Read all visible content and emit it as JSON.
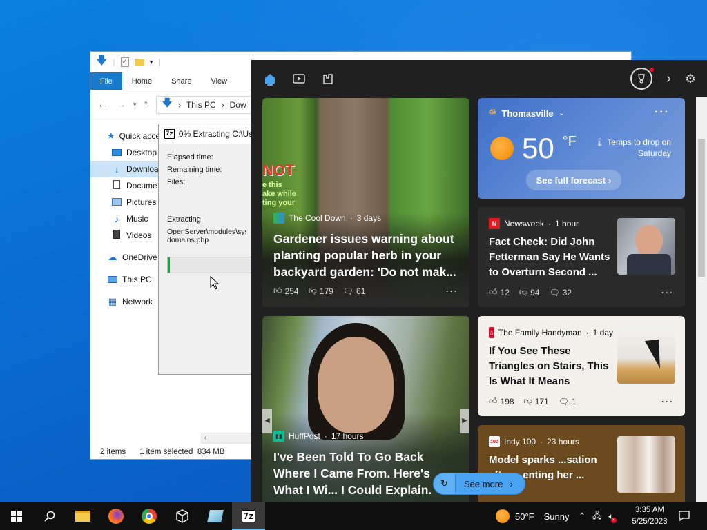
{
  "explorer": {
    "ribbon_tabs": [
      "File",
      "Home",
      "Share",
      "View"
    ],
    "breadcrumb": [
      "This PC",
      "Dow"
    ],
    "nav": [
      {
        "label": "Quick acce",
        "icon": "star-icon"
      },
      {
        "label": "Desktop",
        "icon": "desktop-icon"
      },
      {
        "label": "Downloa",
        "icon": "download-icon"
      },
      {
        "label": "Docume",
        "icon": "document-icon"
      },
      {
        "label": "Pictures",
        "icon": "pictures-icon"
      },
      {
        "label": "Music",
        "icon": "music-icon"
      },
      {
        "label": "Videos",
        "icon": "videos-icon"
      },
      {
        "label": "OneDrive",
        "icon": "cloud-icon"
      },
      {
        "label": "This PC",
        "icon": "pc-icon"
      },
      {
        "label": "Network",
        "icon": "network-icon"
      }
    ],
    "status": {
      "items": "2 items",
      "selected": "1 item selected",
      "size": "834 MB"
    }
  },
  "zip_dialog": {
    "logo": "7z",
    "title": "0% Extracting C:\\Us",
    "elapsed_label": "Elapsed time:",
    "remaining_label": "Remaining time:",
    "files_label": "Files:",
    "extracting_label": "Extracting",
    "path_line1": "OpenServer\\modules\\syst",
    "path_line2": "domains.php",
    "progress": 0.02
  },
  "widgets": {
    "weather": {
      "location": "Thomasville",
      "temp": "50",
      "unit": "°F",
      "alert": "Temps to drop on Saturday",
      "forecast_btn": "See full forecast"
    },
    "cards": [
      {
        "source": "The Cool Down",
        "age": "3 days",
        "headline": "Gardener issues warning about planting popular herb in your backyard garden: 'Do not mak...",
        "likes": "254",
        "dislikes": "179",
        "comments": "61",
        "overlay_text": "NOT",
        "overlay_sub": "e this\nake while\nting your"
      },
      {
        "source": "Newsweek",
        "age": "1 hour",
        "headline": "Fact Check: Did John Fetterman Say He Wants to Overturn Second ...",
        "likes": "12",
        "dislikes": "94",
        "comments": "32"
      },
      {
        "source": "The Family Handyman",
        "age": "1 day",
        "headline": "If You See These Triangles on Stairs, This Is What It Means",
        "likes": "198",
        "dislikes": "171",
        "comments": "1"
      },
      {
        "source": "HuffPost",
        "age": "17 hours",
        "headline": "I've Been Told To Go Back Where I Came From. Here's What I Wi... I Could Explain."
      },
      {
        "source": "Indy 100",
        "age": "23 hours",
        "headline": "Model sparks ...sation after ...enting her ..."
      }
    ],
    "see_more": "See more"
  },
  "taskbar": {
    "weather_temp": "50°F",
    "weather_desc": "Sunny",
    "time": "3:35 AM",
    "date": "5/25/2023"
  }
}
